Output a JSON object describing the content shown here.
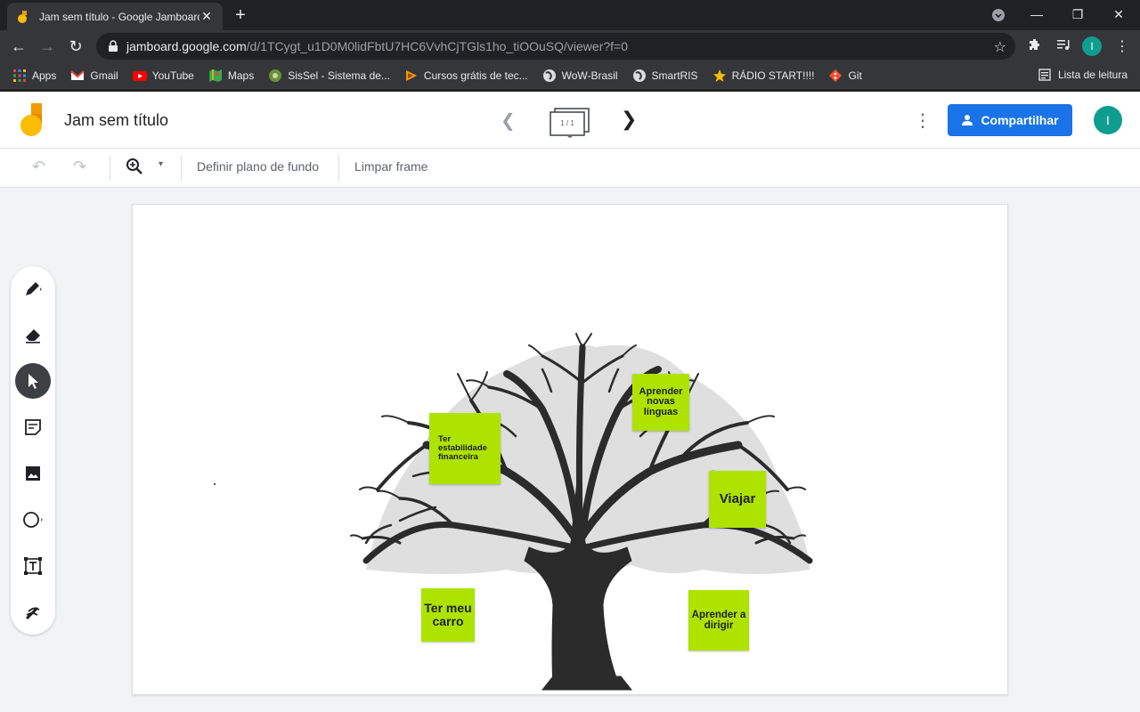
{
  "browser": {
    "tab_title": "Jam sem título - Google Jamboard",
    "url_host": "jamboard.google.com",
    "url_path": "/d/1TCygt_u1D0M0lidFbtU7HC6VvhCjTGls1ho_tiOOuSQ/viewer?f=0",
    "profile_initial": "I",
    "bookmarks": [
      {
        "label": "Apps",
        "icon": "apps-grid-icon",
        "color": "#ea4335"
      },
      {
        "label": "Gmail",
        "icon": "gmail-icon",
        "color": "#ea4335"
      },
      {
        "label": "YouTube",
        "icon": "youtube-icon",
        "color": "#ff0000"
      },
      {
        "label": "Maps",
        "icon": "maps-icon",
        "color": "#34a853"
      },
      {
        "label": "SisSel - Sistema de...",
        "icon": "sissel-icon",
        "color": "#6a8f3a"
      },
      {
        "label": "Cursos grátis de tec...",
        "icon": "cursos-icon",
        "color": "#f29900"
      },
      {
        "label": "WoW-Brasil",
        "icon": "globe-icon",
        "color": "#dadce0"
      },
      {
        "label": "SmartRIS",
        "icon": "globe-icon",
        "color": "#dadce0"
      },
      {
        "label": "RÁDIO START!!!!",
        "icon": "star-icon",
        "color": "#fbbc04"
      },
      {
        "label": "Git",
        "icon": "git-icon",
        "color": "#f1502f"
      }
    ],
    "reading_list_label": "Lista de leitura"
  },
  "app": {
    "doc_title": "Jam sem título",
    "frame_counter": "1 / 1",
    "share_label": "Compartilhar",
    "user_initial": "I",
    "set_background_label": "Definir plano de fundo",
    "clear_frame_label": "Limpar frame",
    "accent_color": "#1a73e8",
    "note_color": "#aee300"
  },
  "notes": [
    {
      "text": "Aprender novas línguas"
    },
    {
      "text": "Ter estabilidade financeira"
    },
    {
      "text": "Viajar"
    },
    {
      "text": "Ter meu carro"
    },
    {
      "text": "Aprender a dirigir"
    }
  ],
  "tools": [
    {
      "name": "pen-tool",
      "icon": "pen-icon"
    },
    {
      "name": "eraser-tool",
      "icon": "eraser-icon"
    },
    {
      "name": "select-tool",
      "icon": "cursor-icon",
      "active": true
    },
    {
      "name": "sticky-note-tool",
      "icon": "sticky-note-icon"
    },
    {
      "name": "image-tool",
      "icon": "image-icon"
    },
    {
      "name": "shape-tool",
      "icon": "circle-icon"
    },
    {
      "name": "text-box-tool",
      "icon": "text-box-icon"
    },
    {
      "name": "laser-tool",
      "icon": "laser-icon"
    }
  ]
}
